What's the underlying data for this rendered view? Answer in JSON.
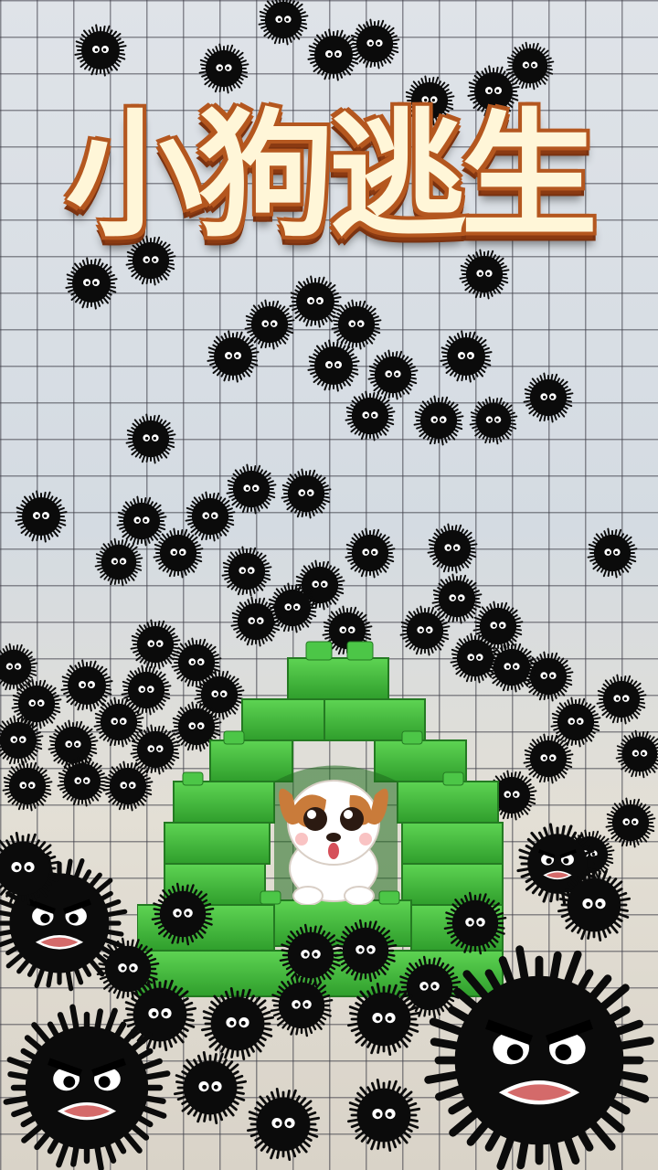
{
  "game": {
    "title": "小狗逃生"
  },
  "colors": {
    "title_fill": "#fff6d8",
    "title_outline": "#b4571f",
    "brick_green": "#3fbf3a",
    "fuzz_black": "#0b0b0b",
    "dog_brown": "#c97b3a"
  },
  "icons": {
    "character": "puppy-icon",
    "enemy": "soot-sprite-icon",
    "shelter": "green-brick-house"
  }
}
